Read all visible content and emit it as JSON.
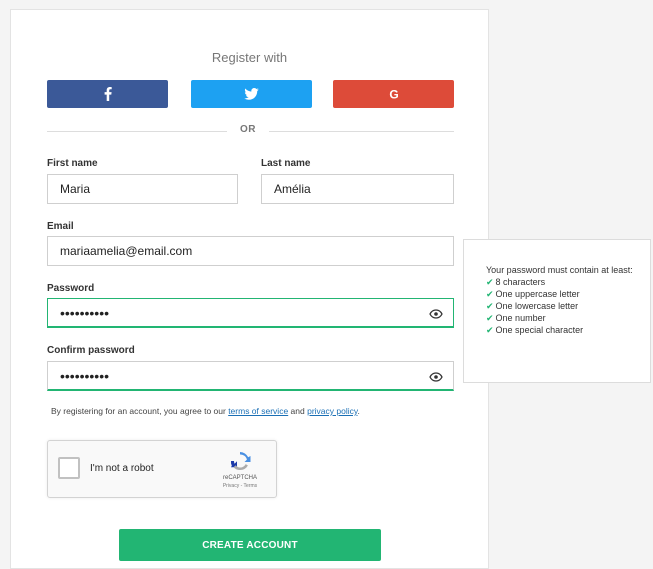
{
  "register": {
    "title": "Register with",
    "social": [
      {
        "name": "facebook",
        "color": "#3b5998",
        "icon": "facebook-icon"
      },
      {
        "name": "twitter",
        "color": "#1da1f2",
        "icon": "twitter-icon"
      },
      {
        "name": "google",
        "color": "#dd4b39",
        "icon": "google-icon"
      }
    ],
    "divider_text": "OR"
  },
  "form": {
    "first_name_label": "First name",
    "first_name_value": "Maria",
    "last_name_label": "Last name",
    "last_name_value": "Amélia",
    "email_label": "Email",
    "email_value": "mariaamelia@email.com",
    "password_label": "Password",
    "password_value": "••••••••••",
    "confirm_label": "Confirm password",
    "confirm_value": "••••••••••",
    "terms_prefix": "By registering for an account, you agree to our ",
    "terms_link": "terms of service",
    "terms_and": " and ",
    "privacy_link": "privacy policy",
    "terms_suffix": ".",
    "submit_label": "CREATE ACCOUNT",
    "accent_color": "#22b573"
  },
  "captcha": {
    "label": "I'm not a robot",
    "brand": "reCAPTCHA",
    "links": "Privacy - Terms"
  },
  "password_rules": {
    "heading": "Your password must contain at least:",
    "items": [
      "8 characters",
      "One uppercase letter",
      "One lowercase letter",
      "One number",
      "One special character"
    ]
  }
}
